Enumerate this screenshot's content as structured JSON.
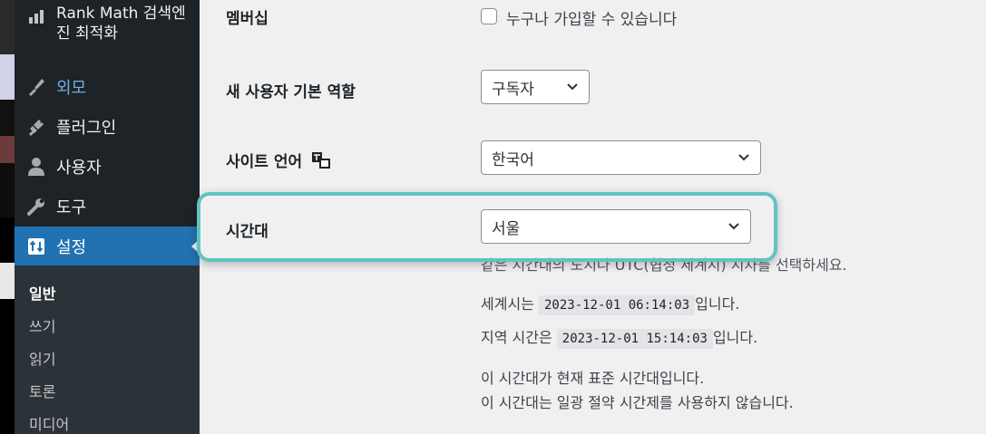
{
  "sidebar": {
    "rank_math_label": "Rank Math 검색엔진 최적화",
    "items": [
      {
        "label": "외모",
        "icon": "paintbrush-icon"
      },
      {
        "label": "플러그인",
        "icon": "plug-icon"
      },
      {
        "label": "사용자",
        "icon": "user-icon"
      },
      {
        "label": "도구",
        "icon": "wrench-icon"
      },
      {
        "label": "설정",
        "icon": "settings-icon"
      }
    ],
    "submenu": [
      "일반",
      "쓰기",
      "읽기",
      "토론",
      "미디어"
    ]
  },
  "settings": {
    "membership": {
      "label": "멤버십",
      "checkbox_label": "누구나 가입할 수 있습니다",
      "checked": false
    },
    "default_role": {
      "label": "새 사용자 기본 역할",
      "value": "구독자"
    },
    "site_language": {
      "label": "사이트 언어",
      "value": "한국어"
    },
    "timezone": {
      "label": "시간대",
      "value": "서울",
      "description": "같은 시간대의 도시나 UTC(협정 세계시) 시차를 선택하세요.",
      "utc_prefix": "세계시는",
      "utc_time": "2023-12-01 06:14:03",
      "utc_suffix": "입니다.",
      "local_prefix": "지역 시간은",
      "local_time": "2023-12-01 15:14:03",
      "local_suffix": "입니다.",
      "note1": "이 시간대가 현재 표준 시간대입니다.",
      "note2": "이 시간대는 일광 절약 시간제를 사용하지 않습니다."
    }
  },
  "colors": {
    "admin_bar": "#1d2327",
    "accent": "#2271b1",
    "highlight": "#5fc4c0"
  }
}
